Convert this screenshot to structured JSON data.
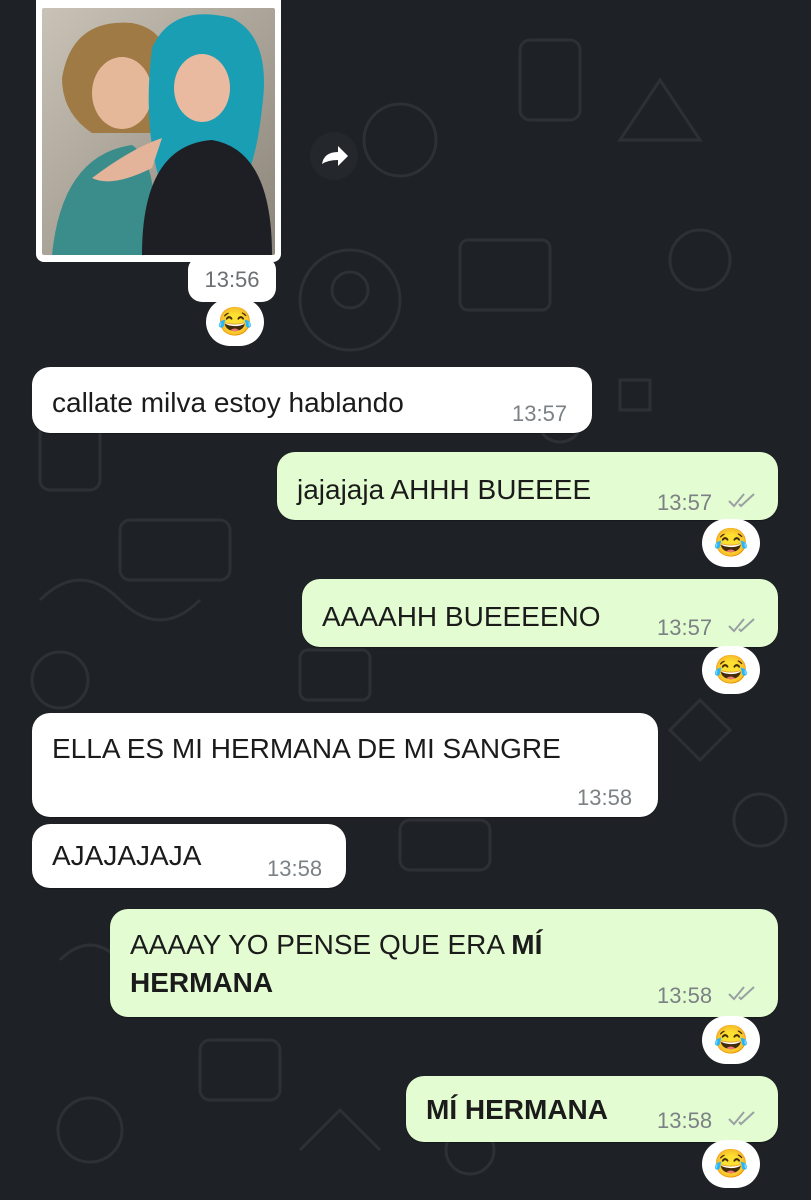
{
  "chat": {
    "photo_message": {
      "time": "13:56",
      "reaction": "😂"
    },
    "messages": [
      {
        "text": "callate milva estoy hablando",
        "time": "13:57"
      },
      {
        "text": "jajajaja AHHH BUEEEE",
        "time": "13:57",
        "reaction": "😂"
      },
      {
        "text": "AAAAHH BUEEEENO",
        "time": "13:57",
        "reaction": "😂"
      },
      {
        "text": "ELLA ES MI HERMANA DE MI SANGRE",
        "time": "13:58"
      },
      {
        "text": "AJAJAJAJA",
        "time": "13:58"
      },
      {
        "text_before": "AAAAY YO PENSE QUE ERA ",
        "text_bold_1": "MÍ",
        "text_bold_2": "HERMANA",
        "time": "13:58",
        "reaction": "😂"
      },
      {
        "text": "MÍ HERMANA",
        "time": "13:58",
        "reaction": "😂"
      }
    ]
  },
  "colors": {
    "background": "#1e2125",
    "incoming_bubble": "#ffffff",
    "outgoing_bubble": "#e3fcd2",
    "read_ticks": "#9aa0a3"
  },
  "icons": [
    "forward-icon",
    "double-check-icon"
  ]
}
